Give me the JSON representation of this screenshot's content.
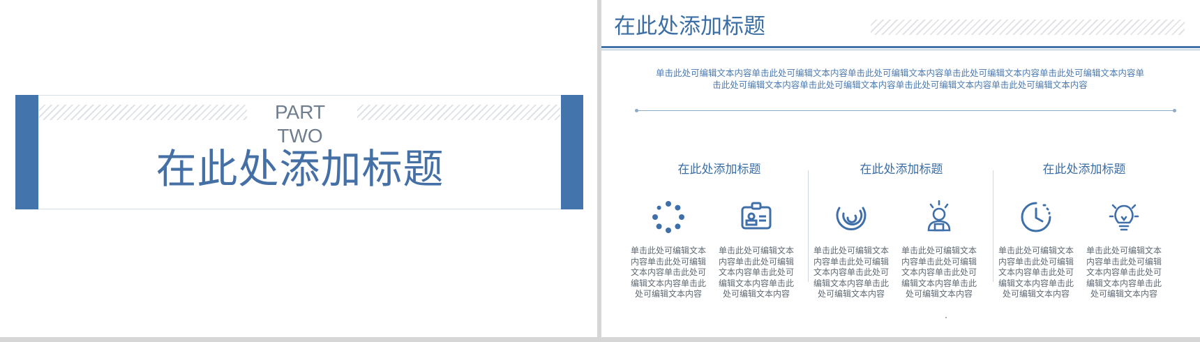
{
  "colors": {
    "accent": "#4375ac",
    "text_blue": "#3b6ea5",
    "gray_text": "#606a74"
  },
  "left_slide": {
    "part_line1": "PART",
    "part_line2": "TWO",
    "title": "在此处添加标题"
  },
  "right_slide": {
    "title": "在此处添加标题",
    "intro": "单击此处可编辑文本内容单击此处可编辑文本内容单击此处可编辑文本内容单击此处可编辑文本内容单击此处可编辑文本内容单击此处可编辑文本内容单击此处可编辑文本内容单击此处可编辑文本内容单击此处可编辑文本内容",
    "columns": [
      {
        "title": "在此处添加标题",
        "items": [
          {
            "icon": "loading-dots-icon",
            "text": "单击此处可编辑文本内容单击此处可编辑文本内容单击此处可编辑文本内容单击此处可编辑文本内容"
          },
          {
            "icon": "id-card-icon",
            "text": "单击此处可编辑文本内容单击此处可编辑文本内容单击此处可编辑文本内容单击此处可编辑文本内容"
          }
        ]
      },
      {
        "title": "在此处添加标题",
        "items": [
          {
            "icon": "spiral-arcs-icon",
            "text": "单击此处可编辑文本内容单击此处可编辑文本内容单击此处可编辑文本内容单击此处可编辑文本内容"
          },
          {
            "icon": "user-idea-icon",
            "text": "单击此处可编辑文本内容单击此处可编辑文本内容单击此处可编辑文本内容单击此处可编辑文本内容"
          }
        ]
      },
      {
        "title": "在此处添加标题",
        "items": [
          {
            "icon": "clock-refresh-icon",
            "text": "单击此处可编辑文本内容单击此处可编辑文本内容单击此处可编辑文本内容单击此处可编辑文本内容"
          },
          {
            "icon": "lightbulb-icon",
            "text": "单击此处可编辑文本内容单击此处可编辑文本内容单击此处可编辑文本内容单击此处可编辑文本内容"
          }
        ]
      }
    ]
  }
}
